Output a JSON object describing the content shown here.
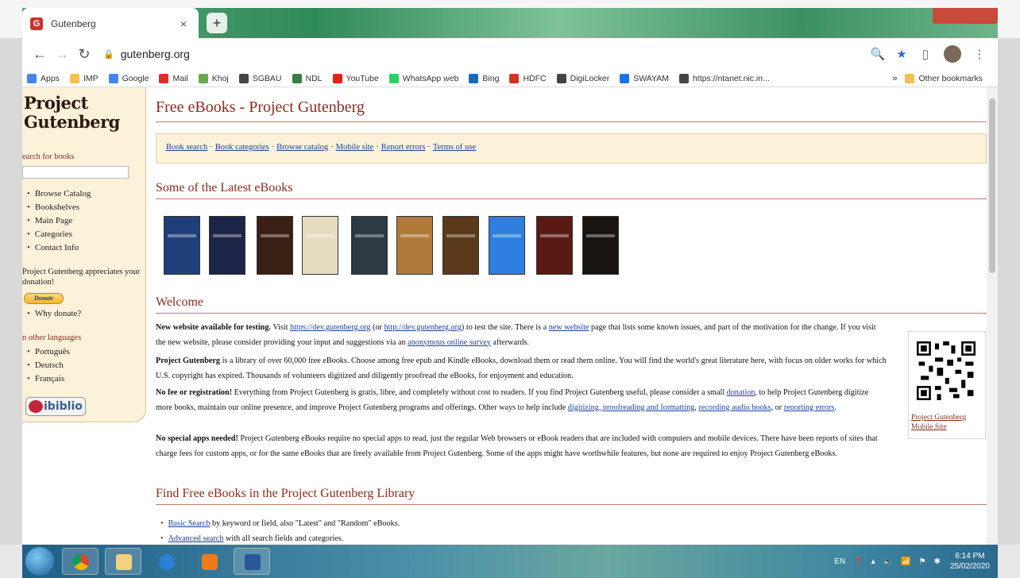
{
  "browser": {
    "tab_title": "Gutenberg",
    "tab_close": "×",
    "new_tab": "+",
    "url": "gutenberg.org",
    "bookmarks": [
      {
        "label": "Apps",
        "icon": "apps-grid-icon",
        "color": "#4285f4"
      },
      {
        "label": "IMP",
        "icon": "folder-icon",
        "color": "#f2c14e"
      },
      {
        "label": "Google",
        "icon": "google-icon",
        "color": "#4285f4"
      },
      {
        "label": "Mail",
        "icon": "gmail-icon",
        "color": "#d93025"
      },
      {
        "label": "Khoj",
        "icon": "khoj-icon",
        "color": "#6aa84f"
      },
      {
        "label": "SGBAU",
        "icon": "globe-icon",
        "color": "#444444"
      },
      {
        "label": "NDL",
        "icon": "ndl-icon",
        "color": "#3a7d44"
      },
      {
        "label": "YouTube",
        "icon": "youtube-icon",
        "color": "#e62117"
      },
      {
        "label": "WhatsApp web",
        "icon": "whatsapp-icon",
        "color": "#25d366"
      },
      {
        "label": "Bing",
        "icon": "bing-icon",
        "color": "#0f6cbd"
      },
      {
        "label": "HDFC",
        "icon": "hdfc-icon",
        "color": "#d93025"
      },
      {
        "label": "DigiLocker",
        "icon": "globe-icon",
        "color": "#444444"
      },
      {
        "label": "SWAYAM",
        "icon": "swayam-icon",
        "color": "#1a73e8"
      },
      {
        "label": "https://ntanet.nic.in...",
        "icon": "globe-icon",
        "color": "#444444"
      }
    ],
    "bookmarks_more": "»",
    "other_bookmarks": "Other bookmarks"
  },
  "sidebar": {
    "logo_line1": "Project",
    "logo_line2": "Gutenberg",
    "search_label": "earch for books",
    "nav": [
      "Browse Catalog",
      "Bookshelves",
      "Main Page",
      "Categories",
      "Contact Info"
    ],
    "appreciate": "Project Gutenberg appreciates your donation!",
    "donate": "Donate",
    "why_donate": "Why donate?",
    "other_languages_label": "n other languages",
    "languages": [
      "Português",
      "Deutsch",
      "Français"
    ],
    "ibiblio": "ibiblio"
  },
  "main": {
    "title": "Free eBooks - Project Gutenberg",
    "nav_links": [
      "Book search",
      "Book categories",
      "Browse catalog",
      "Mobile site",
      "Report errors",
      "Terms of use"
    ],
    "nav_sep": "·",
    "latest_heading": "Some of the Latest eBooks",
    "covers": [
      "#1e3f7a",
      "#1c2447",
      "#3a1f14",
      "#e6dcc0",
      "#2d3a44",
      "#b07a3a",
      "#5a3a1a",
      "#2f7fe0",
      "#5a1a14",
      "#1a1410"
    ],
    "welcome_heading": "Welcome",
    "p1": {
      "bold": "New website available for testing.",
      "t1": " Visit ",
      "link1": "https://dev.gutenberg.org",
      "t2": " (or ",
      "link2": "http://dev.gutenberg.org",
      "t3": ") to test the site. There is a ",
      "link3": "new website",
      "t4": " page that lists some known issues, and part of the motivation for the change. If you visit the new website, please consider providing your input and suggestions via an ",
      "link4": "anonymous online survey",
      "t5": " afterwards."
    },
    "p2": {
      "bold": "Project Gutenberg",
      "text": " is a library of over 60,000 free eBooks. Choose among free epub and Kindle eBooks, download them or read them online. You will find the world's great literature here, with focus on older works for which U.S. copyright has expired. Thousands of volunteers digitized and diligently proofread the eBooks, for enjoyment and education."
    },
    "p3": {
      "bold": "No fee or registration!",
      "t1": " Everything from Project Gutenberg is gratis, libre, and completely without cost to readers. If you find Project Gutenberg useful, please consider a small ",
      "link1": "donation",
      "t2": ", to help Project Gutenberg digitize more books, maintain our online presence, and improve Project Gutenberg programs and offerings. Other ways to help include ",
      "link2": "digitizing, proofreading and formatting",
      "t3": ", ",
      "link3": "recording audio books",
      "t4": ", or ",
      "link4": "reporting errors",
      "t5": "."
    },
    "p4": {
      "bold": "No special apps needed!",
      "text": " Project Gutenberg eBooks require no special apps to read, just the regular Web browsers or eBook readers that are included with computers and mobile devices. There have been reports of sites that charge fees for custom apps, or for the same eBooks that are freely available from Project Gutenberg. Some of the apps might have worthwhile features, but none are required to enjoy Project Gutenberg eBooks."
    },
    "qr_caption": "Project Gutenberg Mobile Site",
    "find_heading": "Find Free eBooks in the Project Gutenberg Library",
    "find_items": [
      {
        "link": "Basic Search",
        "text": " by keyword or field, also \"Latest\" and \"Random\" eBooks."
      },
      {
        "link": "Advanced search",
        "text": " with all search fields and categories."
      }
    ]
  },
  "taskbar": {
    "lang": "EN",
    "time": "6:14 PM",
    "date": "25/02/2020"
  }
}
